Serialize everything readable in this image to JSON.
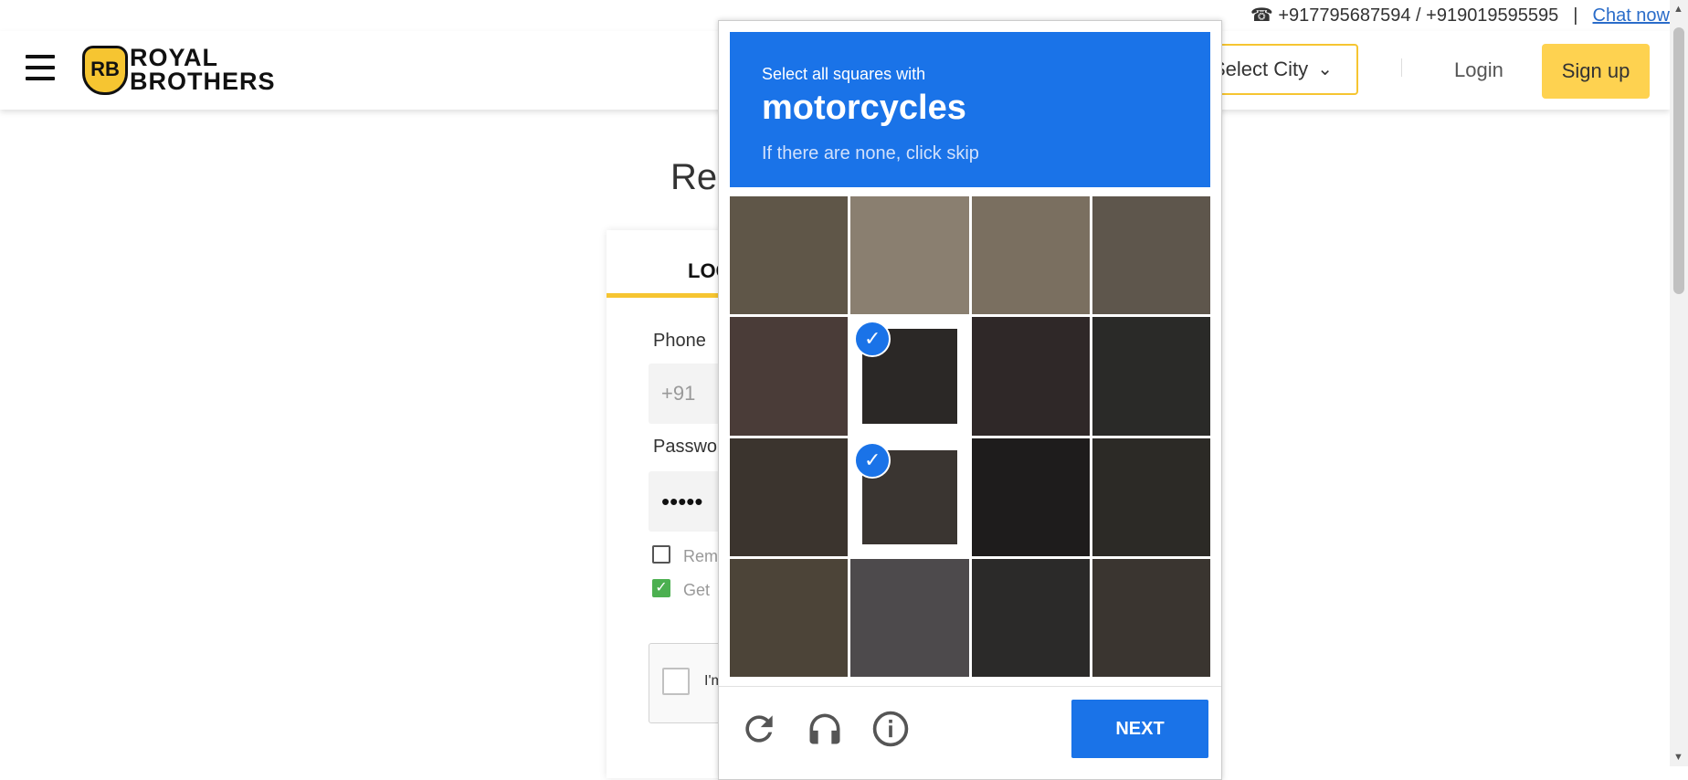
{
  "contact": {
    "phones": "+917795687594 / +919019595595",
    "separator": "|",
    "chat": "Chat now"
  },
  "header": {
    "logo_initials": "RB",
    "logo_line1": "ROYAL",
    "logo_line2": "BROTHERS",
    "city": "Select City",
    "login": "Login",
    "signup": "Sign up"
  },
  "page": {
    "title_partial": "Rer",
    "tab_partial": "LOC",
    "phone_label": "Phone",
    "country_code": "+91",
    "password_label": "Passwo",
    "password_masked": "•••••",
    "remember_partial": "Rem",
    "get_partial": "Get",
    "recaptcha_partial": "I'm"
  },
  "challenge": {
    "instruction": "Select all squares with",
    "target": "motorcycles",
    "hint": "If there are none, click skip",
    "tiles": [
      {
        "selected": false,
        "color": "#5f5648"
      },
      {
        "selected": false,
        "color": "#8a7f70"
      },
      {
        "selected": false,
        "color": "#7a6f60"
      },
      {
        "selected": false,
        "color": "#5e564c"
      },
      {
        "selected": false,
        "color": "#4a3c38"
      },
      {
        "selected": true,
        "color": "#2b2826"
      },
      {
        "selected": false,
        "color": "#2f2828"
      },
      {
        "selected": false,
        "color": "#2a2a28"
      },
      {
        "selected": false,
        "color": "#3b342e"
      },
      {
        "selected": true,
        "color": "#3a3531"
      },
      {
        "selected": false,
        "color": "#1e1c1c"
      },
      {
        "selected": false,
        "color": "#2c2a26"
      },
      {
        "selected": false,
        "color": "#4c4438"
      },
      {
        "selected": false,
        "color": "#4d4a4c"
      },
      {
        "selected": false,
        "color": "#2b2a29"
      },
      {
        "selected": false,
        "color": "#3a3530"
      }
    ],
    "next": "NEXT",
    "icons": [
      "reload-icon",
      "audio-icon",
      "info-icon"
    ]
  }
}
